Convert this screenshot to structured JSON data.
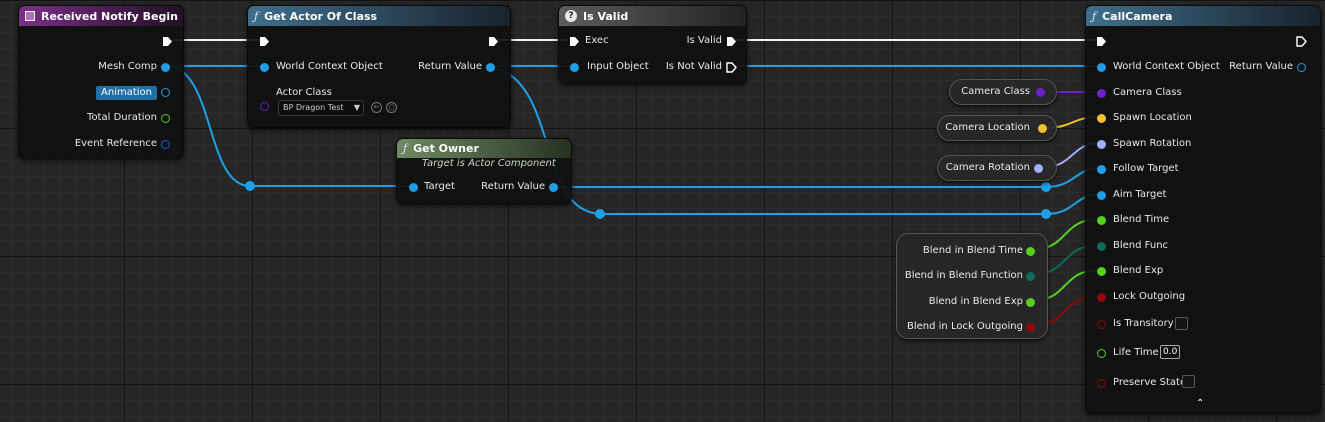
{
  "nodes": {
    "received_notify_begin": {
      "title": "Received Notify Begin",
      "pins": {
        "mesh_comp": "Mesh Comp",
        "animation": "Animation",
        "total_duration": "Total Duration",
        "event_reference": "Event Reference"
      }
    },
    "get_actor_of_class": {
      "title": "Get Actor Of Class",
      "pins": {
        "world_context": "World Context Object",
        "actor_class": "Actor Class",
        "return_value": "Return Value"
      },
      "actor_class_value": "BP Dragon Test"
    },
    "is_valid": {
      "title": "Is Valid",
      "pins": {
        "exec": "Exec",
        "input_object": "Input Object",
        "is_valid": "Is Valid",
        "is_not_valid": "Is Not Valid"
      }
    },
    "get_owner": {
      "title": "Get Owner",
      "subtitle": "Target is Actor Component",
      "pins": {
        "target": "Target",
        "return_value": "Return Value"
      }
    },
    "call_camera": {
      "title": "CallCamera",
      "pins": {
        "world_context": "World Context Object",
        "return_value": "Return Value",
        "camera_class": "Camera Class",
        "spawn_location": "Spawn Location",
        "spawn_rotation": "Spawn Rotation",
        "follow_target": "Follow Target",
        "aim_target": "Aim Target",
        "blend_time": "Blend Time",
        "blend_func": "Blend Func",
        "blend_exp": "Blend Exp",
        "lock_outgoing": "Lock Outgoing",
        "is_transitory": "Is Transitory",
        "life_time": "Life Time",
        "preserve_state": "Preserve State"
      },
      "life_time_value": "0.0"
    },
    "camera_class_var": {
      "label": "Camera Class"
    },
    "camera_location_var": {
      "label": "Camera Location"
    },
    "camera_rotation_var": {
      "label": "Camera Rotation"
    },
    "blend_vars": {
      "blend_in_blend_time": "Blend in Blend Time",
      "blend_in_blend_function": "Blend in Blend Function",
      "blend_in_blend_exp": "Blend in Blend Exp",
      "blend_in_lock_outgoing": "Blend in Lock Outgoing"
    }
  },
  "colors": {
    "object": "#1fa0e6",
    "class": "#6e1fc8",
    "vector": "#f2c22a",
    "rotator": "#a0b0ff",
    "float": "#54d11f",
    "byte": "#0b6b5e",
    "bool": "#8c0a0a"
  }
}
